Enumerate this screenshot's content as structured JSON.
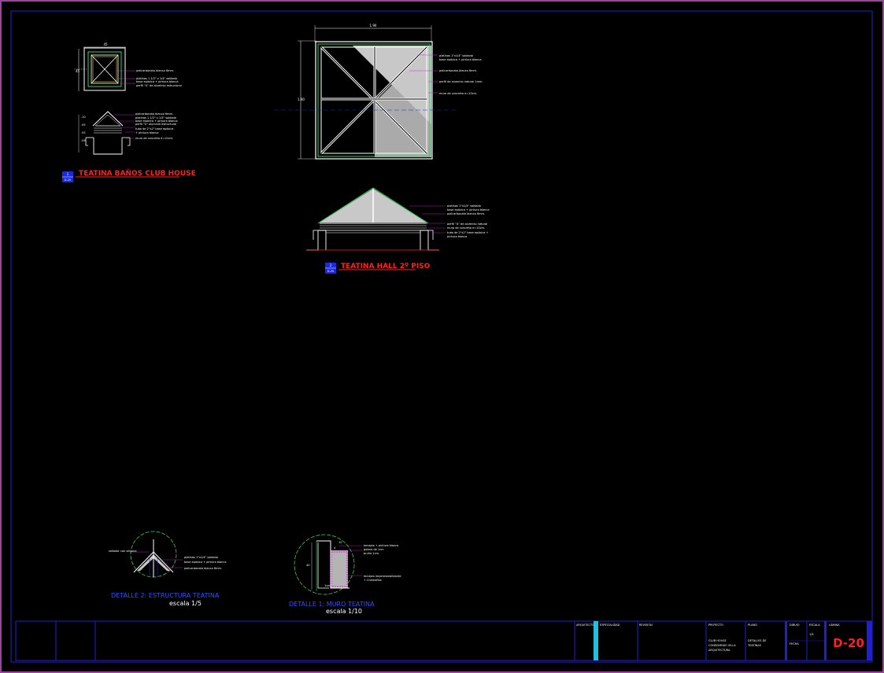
{
  "drawing": {
    "sheet_code": "D-20",
    "detail1": {
      "number": "1",
      "sheet_ref": "D-20",
      "title": "TEATINA BAÑOS CLUB HOUSE",
      "plan_dim_top": "45",
      "plan_dim_side": "45",
      "plan_notes": [
        "policarbonato blanco 6mm.",
        "platinas 1 1/2\" x 1/4\" soldado",
        "base epóxica + pintura blanca",
        "perfil \"U\" de aluminio estructural"
      ],
      "section_notes": [
        "policarbonato blanco 6mm.",
        "platinas 1 1/2\" x 1/4\" soldado",
        "base epóxica + pintura blanca",
        "perfil \"U\" aluminio estructural",
        "tubo de 2\"x2\" base epóxica",
        "+ pintura blanca",
        "muro de concreto e=10cm."
      ]
    },
    "detail2": {
      "number": "2",
      "sheet_ref": "D-20",
      "title": "TEATINA HALL 2º PISO",
      "plan_dim_top": "1.90",
      "plan_dim_side": "1.90",
      "plan_notes": [
        "platinas 1\"x1/4\" soldado",
        "base epóxica + pintura blanca",
        "policarbonato blanco 6mm.",
        "perfil de aluminio natural 1mm.",
        "muro de concreto e=10cm."
      ],
      "section_notes": [
        "platinas 1\"x1/4\" soldado",
        "base epóxica + pintura blanca",
        "policarbonato blanco 6mm.",
        "perfil \"U\" de aluminio natural",
        "muro de concreto e=10cm.",
        "tubo de 2\"x2\" base epóxica +",
        "pintura blanca"
      ]
    },
    "detail3": {
      "title": "DETALLE 2: ESTRUCTURA TEATINA",
      "scale": "escala 1/5",
      "notes": [
        "sellador con silicona",
        "platinas 1\"x1/4\" soldado",
        "base epóxica + pintura blanca",
        "policarbonato blanco 6mm."
      ]
    },
    "detail4": {
      "title": "DETALLE 1: MURO TEATINA",
      "scale": "escala 1/10",
      "notes": [
        "tarrajeo + pintura blanca",
        "gotero de 1cm",
        "bruña 1cm.",
        "tarrajeo impermeabilizante",
        "+ Chemaflex"
      ],
      "dims": [
        "10",
        "40",
        "4",
        "10",
        "1cm"
      ]
    },
    "title_block": {
      "project_label": "PROYECTO",
      "project_lines": [
        "CLUB HOUSE",
        "CONDOMINIO VILLA",
        "ARQUITECTURA"
      ],
      "plan_label": "PLANO",
      "plan_lines": [
        "DETALLES DE",
        "TEATINAS"
      ],
      "drawn_label": "DIBUJO",
      "date_label": "FECHA",
      "scale_label": "ESCALA",
      "scale_value": "1/5",
      "lamina_label": "LÁMINA",
      "empty_labels": [
        "ARQUITECTO",
        "ESPECIALIDAD",
        "REVISIÓN"
      ]
    },
    "colors": {
      "background": "#000000",
      "frame": "#a040a0",
      "inner_frame": "#2020d0",
      "white": "#ffffff",
      "green": "#30d060",
      "cyan": "#20c0e0",
      "magenta": "#e020e0",
      "red": "#ff2020",
      "yellow": "#e0e020",
      "title_blue": "#3050ff",
      "fill": "#c8c8c8"
    }
  }
}
